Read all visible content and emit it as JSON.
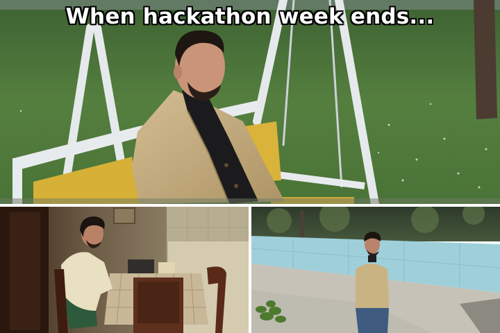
{
  "meme": {
    "caption": "When hackathon week ends..."
  },
  "panels": [
    {
      "scene": "man-on-swing"
    },
    {
      "scene": "man-at-table"
    },
    {
      "scene": "man-by-empty-pool"
    }
  ],
  "colors": {
    "grass": "#4f7a3c",
    "coat": "#c4ab7c",
    "swing_frame": "#e8ebee",
    "cushion": "#d6b037",
    "pool_tile": "#9fd0da",
    "background": "#ffffff"
  }
}
